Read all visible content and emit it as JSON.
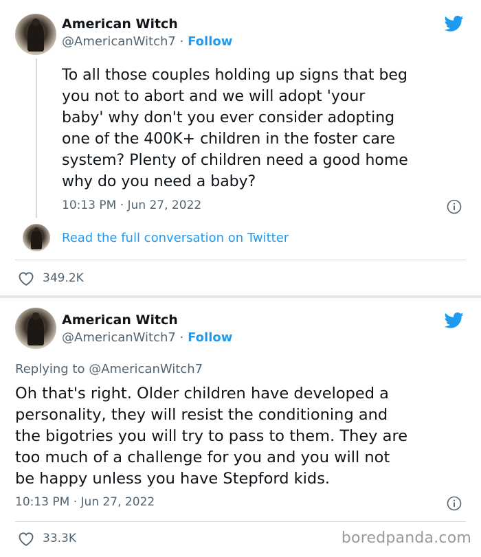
{
  "tweet1": {
    "author_name": "American Witch",
    "handle": "@AmericanWitch7",
    "separator_dot": "·",
    "follow_label": "Follow",
    "lines": [
      "To all those couples holding up signs that beg",
      "you not to abort and we will adopt 'your",
      "baby' why don't you ever consider adopting",
      "one of the 400K+ children in the foster care",
      "system? Plenty of children need a good home",
      "why do you need a baby?"
    ],
    "timestamp": "10:13 PM · Jun 27, 2022",
    "read_more": "Read the full conversation on Twitter",
    "likes": "349.2K"
  },
  "tweet2": {
    "author_name": "American Witch",
    "handle": "@AmericanWitch7",
    "separator_dot": "·",
    "follow_label": "Follow",
    "replying_to": "Replying to @AmericanWitch7",
    "lines": [
      "Oh that's right. Older children have developed a",
      "personality, they will resist the conditioning and",
      "the bigotries you will try to pass to them. They are",
      "too much of a challenge for you and you will not",
      "be happy unless you have Stepford kids."
    ],
    "timestamp": "10:13 PM · Jun 27, 2022",
    "likes": "33.3K"
  },
  "watermark": "boredpanda.com",
  "icons": {
    "brand": "twitter-bird-icon",
    "info": "info-icon",
    "like": "heart-icon"
  },
  "colors": {
    "accent": "#1d9bf0",
    "text": "#0f1419",
    "muted": "#536471",
    "divider": "#cfd9de"
  }
}
